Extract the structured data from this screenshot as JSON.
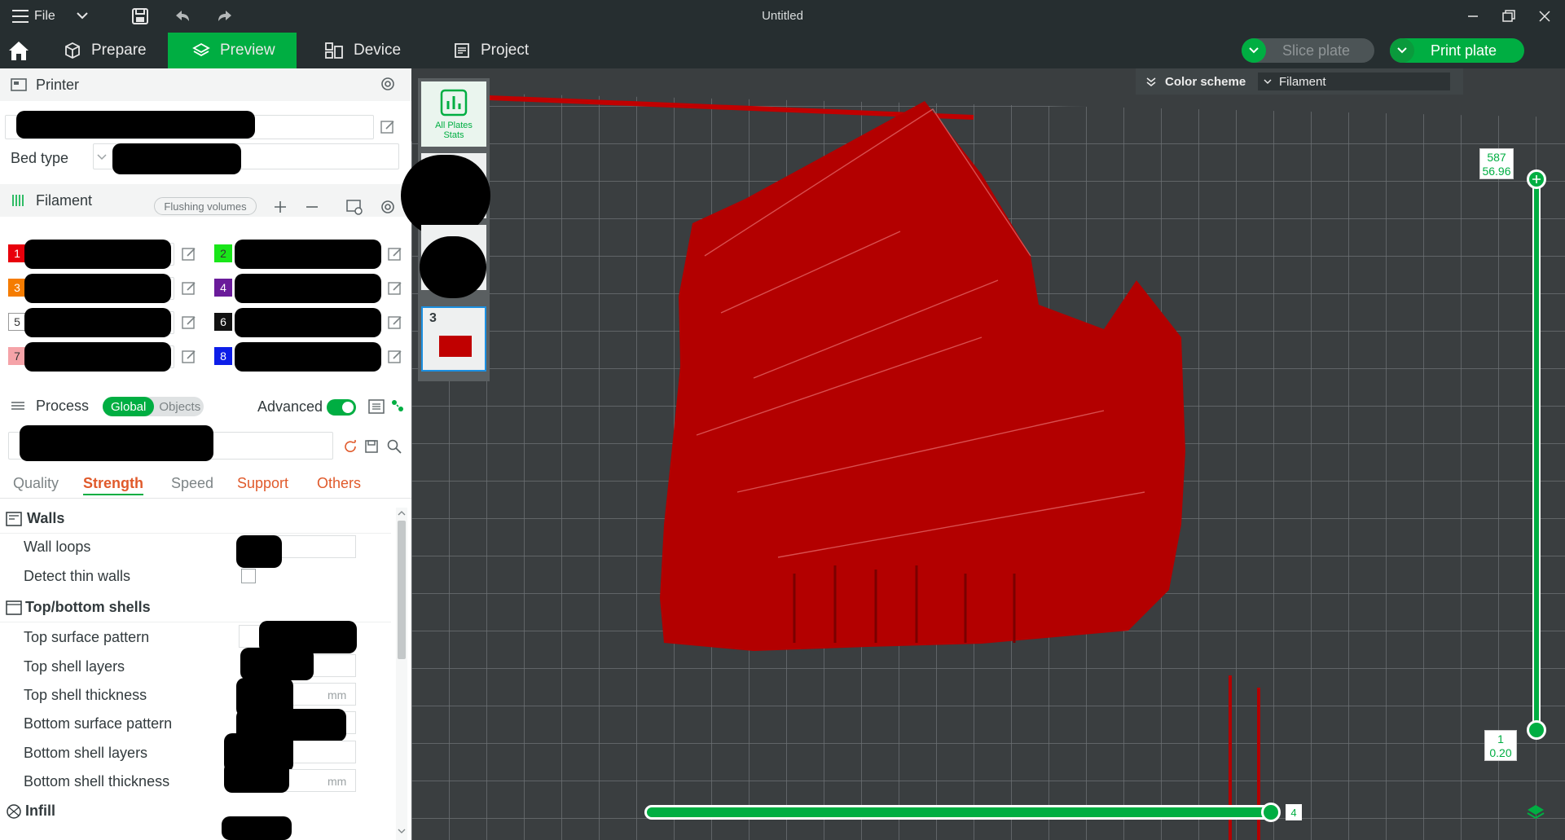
{
  "titlebar": {
    "file_label": "File",
    "title": "Untitled"
  },
  "tabs": [
    {
      "label": "Prepare"
    },
    {
      "label": "Preview"
    },
    {
      "label": "Device"
    },
    {
      "label": "Project"
    }
  ],
  "actions": {
    "slice_label": "Slice plate",
    "print_label": "Print plate"
  },
  "printer": {
    "header": "Printer",
    "bed_type_label": "Bed type"
  },
  "filament": {
    "header": "Filament",
    "flushing_label": "Flushing volumes",
    "slots": [
      {
        "num": "1",
        "color": "#e8000b"
      },
      {
        "num": "2",
        "color": "#19e619"
      },
      {
        "num": "3",
        "color": "#f57c00"
      },
      {
        "num": "4",
        "color": "#6a1b9a"
      },
      {
        "num": "5",
        "color": "#ffffff"
      },
      {
        "num": "6",
        "color": "#111111"
      },
      {
        "num": "7",
        "color": "#f5a3a8"
      },
      {
        "num": "8",
        "color": "#0d1ee8"
      }
    ]
  },
  "process": {
    "header": "Process",
    "global_label": "Global",
    "objects_label": "Objects",
    "advanced_label": "Advanced",
    "tabs": [
      "Quality",
      "Strength",
      "Speed",
      "Support",
      "Others"
    ]
  },
  "params": {
    "walls_title": "Walls",
    "wall_loops": "Wall loops",
    "detect_thin_walls": "Detect thin walls",
    "shells_title": "Top/bottom shells",
    "top_surface_pattern": "Top surface pattern",
    "top_shell_layers": "Top shell layers",
    "top_shell_thickness": "Top shell thickness",
    "bottom_surface_pattern": "Bottom surface pattern",
    "bottom_shell_layers": "Bottom shell layers",
    "bottom_shell_thickness": "Bottom shell thickness",
    "infill_title": "Infill",
    "unit_mm": "mm"
  },
  "viewport": {
    "color_scheme_label": "Color scheme",
    "color_scheme_value": "Filament",
    "all_plates_label_1": "All Plates",
    "all_plates_label_2": "Stats",
    "plate_3_label": "3",
    "layer_top": "587",
    "height_top": "56.96",
    "layer_bottom": "1",
    "height_bottom": "0.20",
    "move_value": "4"
  },
  "colors": {
    "accent": "#00ae42",
    "model": "#b30000"
  }
}
